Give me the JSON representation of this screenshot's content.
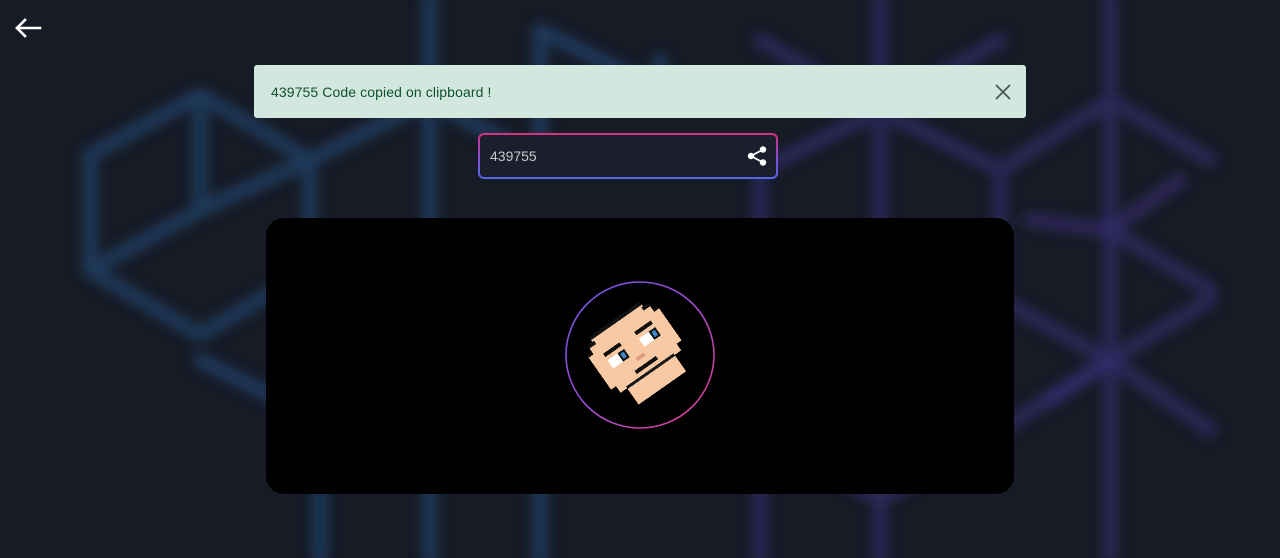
{
  "nav": {
    "back_icon": "arrow-left-icon"
  },
  "toast": {
    "message": "439755 Code copied on clipboard !",
    "close_icon": "close-icon",
    "background": "#d2e8de",
    "text_color": "#0f5132"
  },
  "code_field": {
    "value": "439755",
    "share_icon": "share-icon"
  },
  "video": {
    "avatar_icon": "pixel-face-avatar",
    "background": "#000000"
  },
  "theme": {
    "page_background": "#171b26",
    "accent_pink": "#d6327d",
    "accent_blue": "#5468e8"
  }
}
